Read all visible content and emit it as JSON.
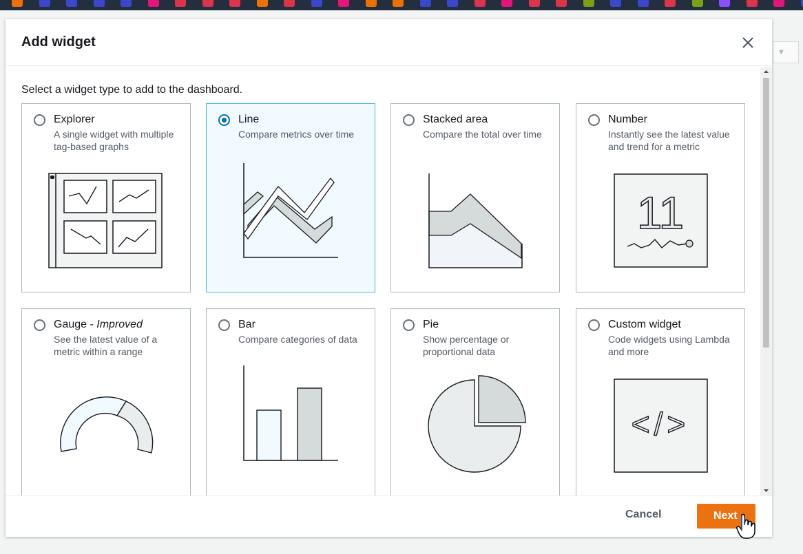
{
  "colors": {
    "accent": "#ec7211",
    "selected_border": "#44b9d6",
    "radio": "#0073bb"
  },
  "modal": {
    "title": "Add widget",
    "intro": "Select a widget type to add to the dashboard.",
    "selected_widget": "Line",
    "widgets": [
      {
        "title": "Explorer",
        "title_em": "",
        "description": "A single widget with multiple tag-based graphs",
        "icon": "explorer-grid-icon",
        "selected": false
      },
      {
        "title": "Line",
        "title_em": "",
        "description": "Compare metrics over time",
        "icon": "line-chart-icon",
        "selected": true
      },
      {
        "title": "Stacked area",
        "title_em": "",
        "description": "Compare the total over time",
        "icon": "stacked-area-icon",
        "selected": false
      },
      {
        "title": "Number",
        "title_em": "",
        "description": "Instantly see the latest value and trend for a metric",
        "icon": "number-icon",
        "selected": false
      },
      {
        "title": "Gauge - ",
        "title_em": "Improved",
        "description": "See the latest value of a metric within a range",
        "icon": "gauge-icon",
        "selected": false
      },
      {
        "title": "Bar",
        "title_em": "",
        "description": "Compare categories of data",
        "icon": "bar-chart-icon",
        "selected": false
      },
      {
        "title": "Pie",
        "title_em": "",
        "description": "Show percentage or proportional data",
        "icon": "pie-chart-icon",
        "selected": false
      },
      {
        "title": "Custom widget",
        "title_em": "",
        "description": "Code widgets using Lambda and more",
        "icon": "code-icon",
        "selected": false
      }
    ],
    "number_icon_text": "11",
    "code_icon_text": "</>",
    "footer": {
      "cancel_label": "Cancel",
      "next_label": "Next"
    }
  }
}
